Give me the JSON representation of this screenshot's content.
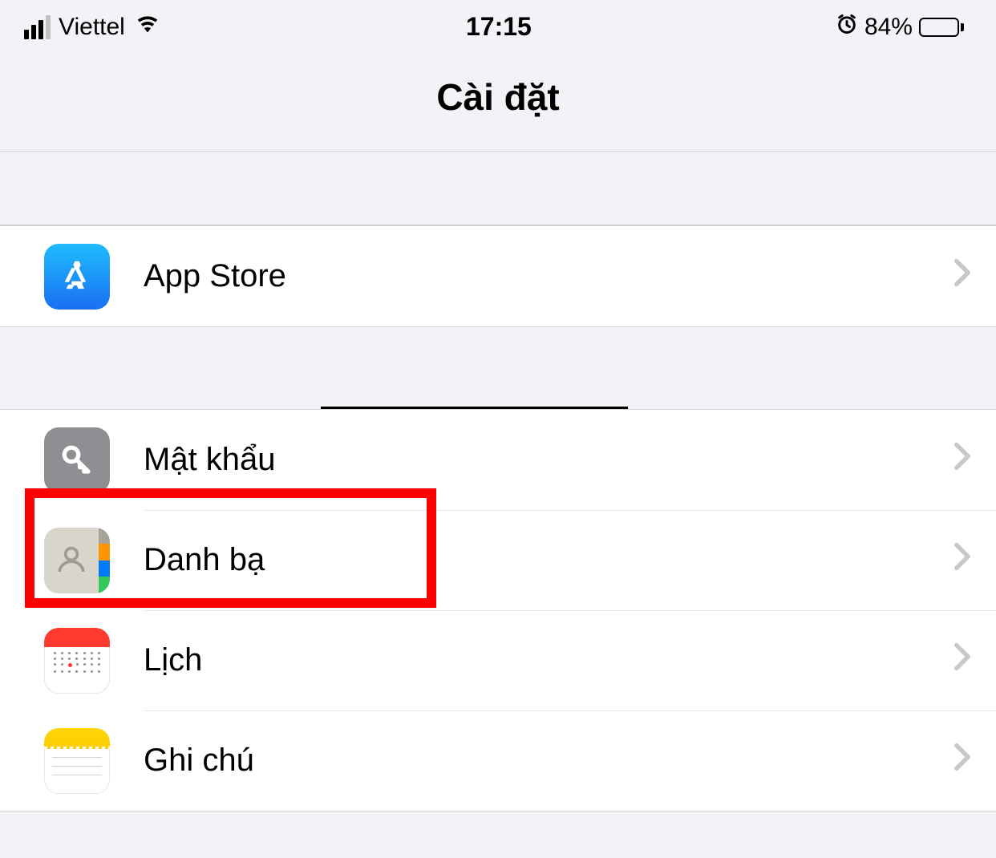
{
  "status_bar": {
    "carrier": "Viettel",
    "time": "17:15",
    "battery_percent": "84%"
  },
  "header": {
    "title": "Cài đặt"
  },
  "section1": {
    "items": [
      {
        "label": "App Store"
      }
    ]
  },
  "section2": {
    "items": [
      {
        "label": "Mật khẩu"
      },
      {
        "label": "Danh bạ"
      },
      {
        "label": "Lịch"
      },
      {
        "label": "Ghi chú"
      }
    ]
  }
}
